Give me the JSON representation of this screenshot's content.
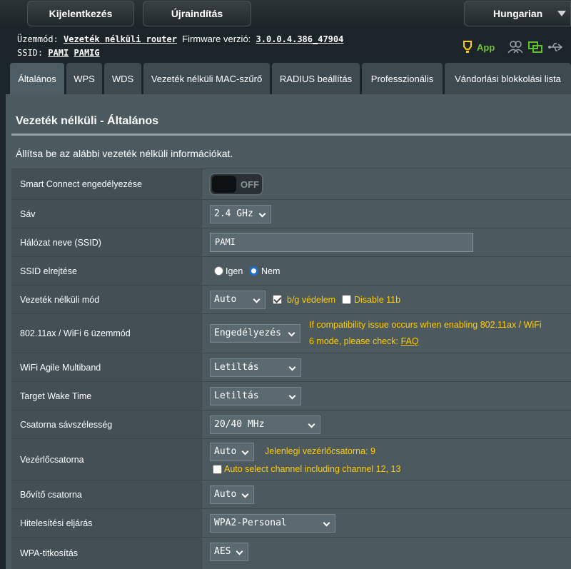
{
  "header": {
    "logout_label": "Kijelentkezés",
    "reboot_label": "Újraindítás",
    "language": "Hungarian"
  },
  "info": {
    "mode_label": "Üzemmód:",
    "mode_value": "Vezeték nélküli router",
    "firmware_label": "Firmware verzió:",
    "firmware_value": "3.0.0.4.386_47904",
    "ssid_label": "SSID:",
    "ssid_1": "PAMI",
    "ssid_2": "PAMIG",
    "app_label": "App"
  },
  "tabs": [
    {
      "label": "Általános",
      "active": true
    },
    {
      "label": "WPS"
    },
    {
      "label": "WDS"
    },
    {
      "label": "Vezeték nélküli MAC-szűrő"
    },
    {
      "label": "RADIUS beállítás"
    },
    {
      "label": "Professzionális"
    },
    {
      "label": "Vándorlási blokkolási lista"
    }
  ],
  "panel": {
    "title": "Vezeték nélküli - Általános",
    "description": "Állítsa be az alábbi vezeték nélküli információkat."
  },
  "rows": {
    "smart_connect": {
      "label": "Smart Connect engedélyezése",
      "toggle": "OFF"
    },
    "band": {
      "label": "Sáv",
      "value": "2.4 GHz"
    },
    "ssid": {
      "label": "Hálózat neve (SSID)",
      "value": "PAMI"
    },
    "hide_ssid": {
      "label": "SSID elrejtése",
      "yes": "Igen",
      "no": "Nem"
    },
    "wireless_mode": {
      "label": "Vezeték nélküli mód",
      "value": "Auto",
      "bg_protection": "b/g védelem",
      "disable_11b": "Disable 11b"
    },
    "ax_mode": {
      "label": "802.11ax / WiFi 6 üzemmód",
      "value": "Engedélyezés",
      "note_line1": "If compatibility issue occurs when enabling 802.11ax / WiFi",
      "note_line2": "6 mode, please check:",
      "faq": "FAQ"
    },
    "agile_multiband": {
      "label": "WiFi Agile Multiband",
      "value": "Letiltás"
    },
    "target_wake_time": {
      "label": "Target Wake Time",
      "value": "Letiltás"
    },
    "bandwidth": {
      "label": "Csatorna sávszélesség",
      "value": "20/40 MHz"
    },
    "control_channel": {
      "label": "Vezérlőcsatorna",
      "value": "Auto",
      "current": "Jelenlegi vezérlőcsatorna: 9",
      "auto_select": "Auto select channel including channel 12, 13"
    },
    "ext_channel": {
      "label": "Bővítő csatorna",
      "value": "Auto"
    },
    "auth_method": {
      "label": "Hitelesítési eljárás",
      "value": "WPA2-Personal"
    },
    "wpa_encryption": {
      "label": "WPA-titkosítás",
      "value": "AES"
    }
  }
}
